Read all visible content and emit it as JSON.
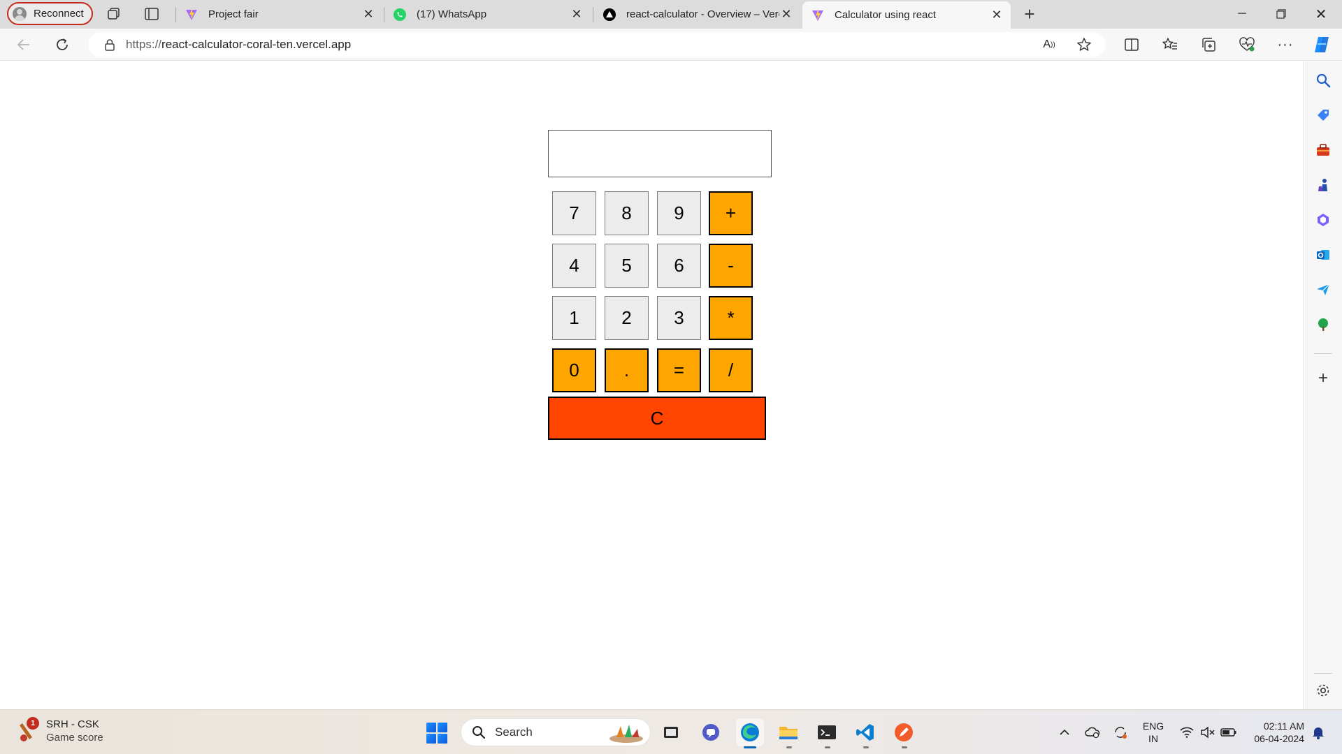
{
  "browser": {
    "profile_label": "Reconnect",
    "tabs": [
      {
        "title": "Project fair",
        "active": false
      },
      {
        "title": "(17) WhatsApp",
        "active": false
      },
      {
        "title": "react-calculator - Overview – Vercel",
        "active": false
      },
      {
        "title": "Calculator using react",
        "active": true
      }
    ],
    "url_scheme": "https://",
    "url_host": "react-calculator-coral-ten.vercel.app"
  },
  "calculator": {
    "display_value": "",
    "keys": [
      "7",
      "8",
      "9",
      "+",
      "4",
      "5",
      "6",
      "-",
      "1",
      "2",
      "3",
      "*",
      "0",
      ".",
      "=",
      "/"
    ],
    "clear_label": "C",
    "colors": {
      "digit": "#ececec",
      "operator": "#ffa500",
      "clear": "#ff4500"
    }
  },
  "taskbar": {
    "widget_title": "SRH - CSK",
    "widget_subtitle": "Game score",
    "widget_badge": "1",
    "search_label": "Search",
    "lang_line1": "ENG",
    "lang_line2": "IN",
    "time": "02:11 AM",
    "date": "06-04-2024"
  },
  "icons": {
    "sidebar": [
      "search-icon",
      "tag-icon",
      "toolbox-icon",
      "chess-icon",
      "copilot-app-icon",
      "outlook-icon",
      "send-icon",
      "tree-icon",
      "add-icon",
      "settings-icon"
    ],
    "taskbar_apps": [
      "file-explorer-dark-icon",
      "teams-icon",
      "edge-icon",
      "folder-icon",
      "terminal-icon",
      "vscode-icon",
      "pen-app-icon"
    ]
  }
}
